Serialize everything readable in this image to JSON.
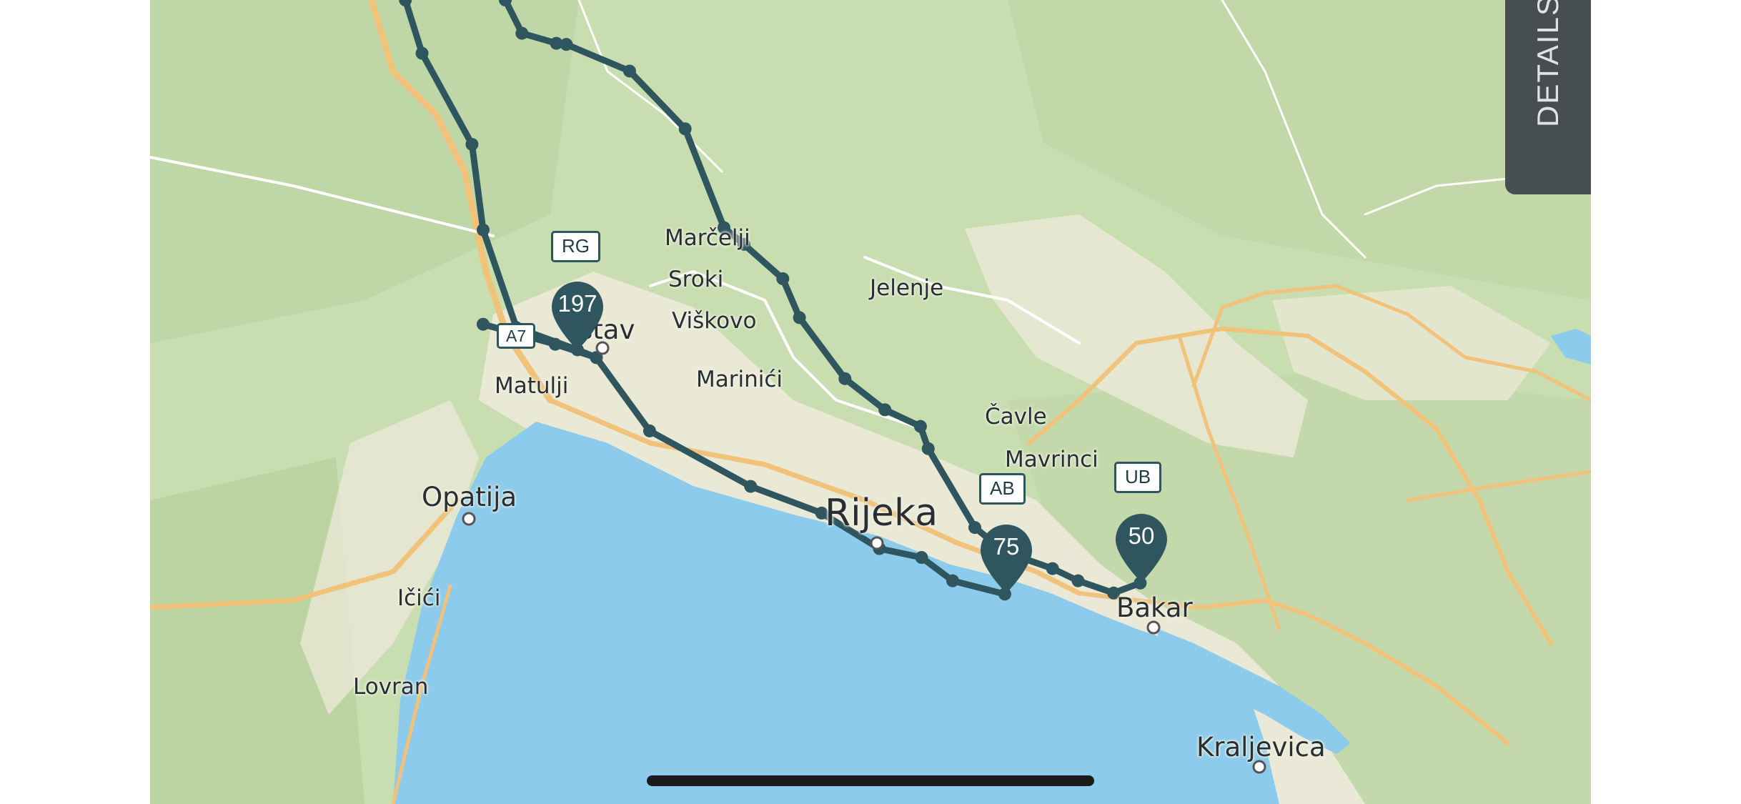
{
  "map": {
    "places": [
      {
        "id": "marcelji",
        "name": "Marčelji"
      },
      {
        "id": "sroki",
        "name": "Sroki"
      },
      {
        "id": "viskovo",
        "name": "Viškovo"
      },
      {
        "id": "jelenje",
        "name": "Jelenje"
      },
      {
        "id": "kastav",
        "name": "stav"
      },
      {
        "id": "matulji",
        "name": "Matulji"
      },
      {
        "id": "marinici",
        "name": "Marinići"
      },
      {
        "id": "cavle",
        "name": "Čavle"
      },
      {
        "id": "mavrinci",
        "name": "Mavrinci"
      },
      {
        "id": "opatija",
        "name": "Opatija"
      },
      {
        "id": "rijeka",
        "name": "Rijeka"
      },
      {
        "id": "bakar",
        "name": "Bakar"
      },
      {
        "id": "icici",
        "name": "Ičići"
      },
      {
        "id": "lovran",
        "name": "Lovran"
      },
      {
        "id": "kraljevica",
        "name": "Kraljevica"
      }
    ],
    "road_label": "A7",
    "tags": [
      "RG",
      "AB",
      "UB"
    ],
    "pins": [
      {
        "id": "pin-rg",
        "label": "197"
      },
      {
        "id": "pin-ab",
        "label": "75"
      },
      {
        "id": "pin-ub",
        "label": "50"
      }
    ],
    "colors": {
      "land": "#c9deb0",
      "urban": "#ece9d8",
      "sea": "#8ccbec",
      "route": "#2f565e",
      "highway": "#f0c27a"
    }
  },
  "details_tab": {
    "label": "DETAILS"
  }
}
